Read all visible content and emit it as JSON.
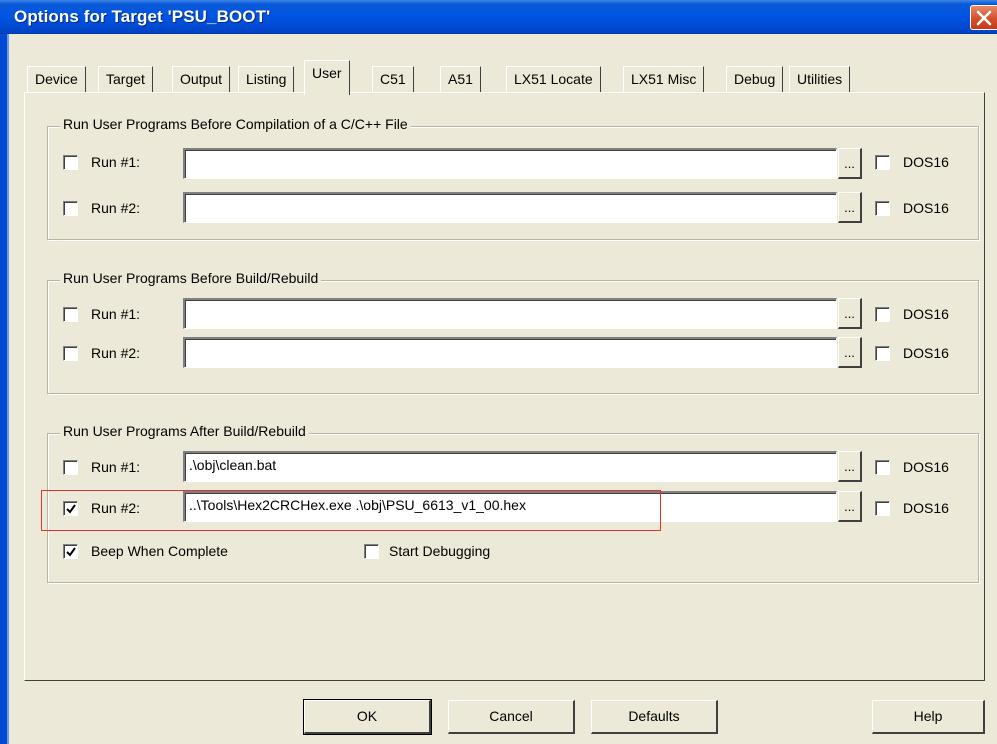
{
  "window": {
    "title": "Options for Target 'PSU_BOOT'"
  },
  "tabs": [
    "Device",
    "Target",
    "Output",
    "Listing",
    "User",
    "C51",
    "A51",
    "LX51 Locate",
    "LX51 Misc",
    "Debug",
    "Utilities"
  ],
  "active_tab": "User",
  "groups": [
    {
      "title": "Run User Programs Before Compilation of a C/C++ File",
      "rows": [
        {
          "label": "Run #1:",
          "checked": false,
          "value": "",
          "browse": "...",
          "dos16": "DOS16",
          "dos16_checked": false
        },
        {
          "label": "Run #2:",
          "checked": false,
          "value": "",
          "browse": "...",
          "dos16": "DOS16",
          "dos16_checked": false
        }
      ]
    },
    {
      "title": "Run User Programs Before Build/Rebuild",
      "rows": [
        {
          "label": "Run #1:",
          "checked": false,
          "value": "",
          "browse": "...",
          "dos16": "DOS16",
          "dos16_checked": false
        },
        {
          "label": "Run #2:",
          "checked": false,
          "value": "",
          "browse": "...",
          "dos16": "DOS16",
          "dos16_checked": false
        }
      ]
    },
    {
      "title": "Run User Programs After Build/Rebuild",
      "rows": [
        {
          "label": "Run #1:",
          "checked": false,
          "value": ".\\obj\\clean.bat",
          "browse": "...",
          "dos16": "DOS16",
          "dos16_checked": false
        },
        {
          "label": "Run #2:",
          "checked": true,
          "value": "..\\Tools\\Hex2CRCHex.exe .\\obj\\PSU_6613_v1_00.hex",
          "browse": "...",
          "dos16": "DOS16",
          "dos16_checked": false
        }
      ],
      "beep": {
        "label": "Beep When Complete",
        "checked": true
      },
      "start_debugging": {
        "label": "Start Debugging",
        "checked": false
      }
    }
  ],
  "buttons": {
    "ok": "OK",
    "cancel": "Cancel",
    "defaults": "Defaults",
    "help": "Help"
  },
  "colors": {
    "titlebar": "#0054e3",
    "dialog_bg": "#ece9d8",
    "highlight_box": "#e03030",
    "close_button": "#d4502c"
  }
}
